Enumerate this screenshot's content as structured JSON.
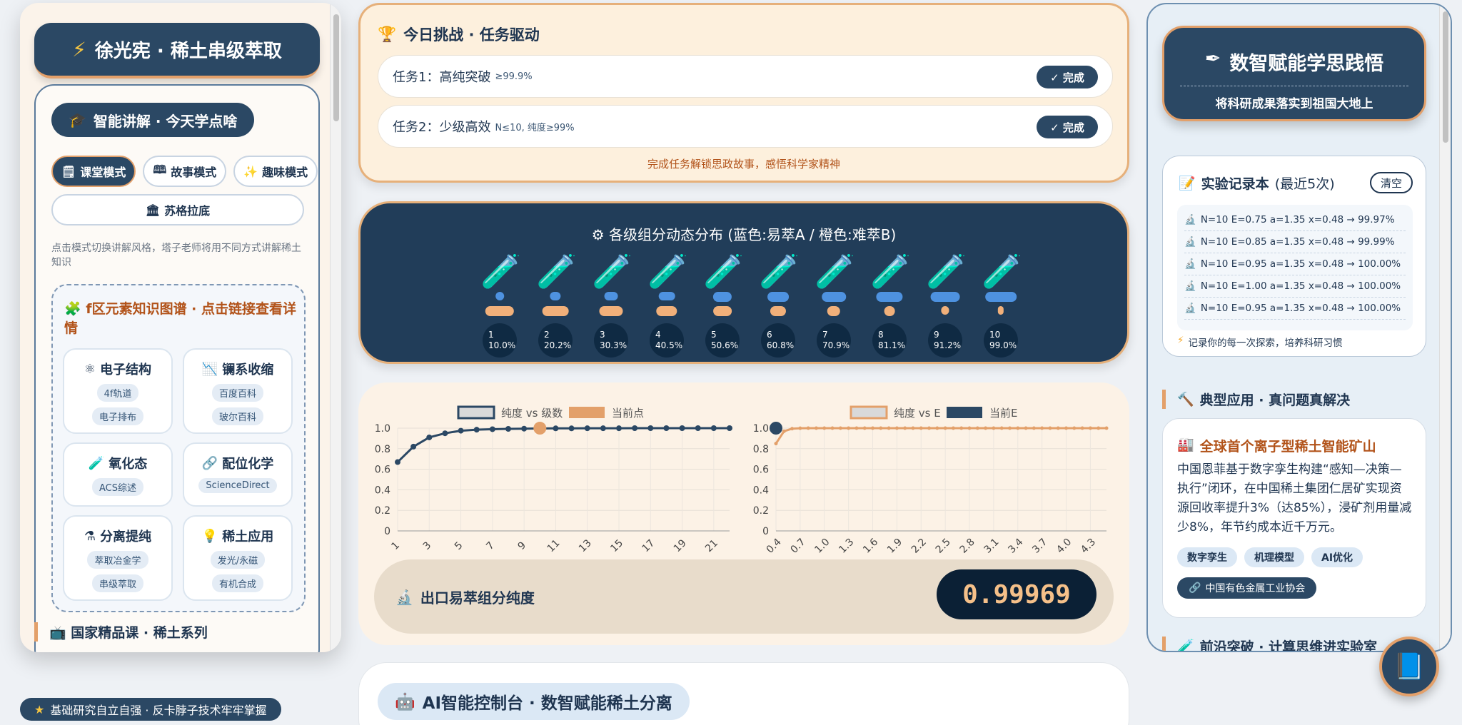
{
  "left": {
    "brand": "徐光宪 · 稀土串级萃取",
    "brand_icon": "lightning-icon",
    "lecture_title": "智能讲解 · 今天学点啥",
    "modes": [
      "课堂模式",
      "故事模式",
      "趣味模式"
    ],
    "socratic": "苏格拉底",
    "hint": "点击模式切换讲解风格，塔子老师将用不同方式讲解稀土知识",
    "kg_title": "f区元素知识图谱 · 点击链接查看详情",
    "cards": [
      {
        "title": "电子结构",
        "tags": [
          "4f轨道",
          "电子排布"
        ]
      },
      {
        "title": "镧系收缩",
        "tags": [
          "百度百科",
          "玻尔百科"
        ]
      },
      {
        "title": "氧化态",
        "tags": [
          "ACS综述"
        ]
      },
      {
        "title": "配位化学",
        "tags": [
          "ScienceDirect"
        ]
      },
      {
        "title": "分离提纯",
        "tags": [
          "萃取冶金学",
          "串级萃取"
        ]
      },
      {
        "title": "稀土应用",
        "tags": [
          "发光/永磁",
          "有机合成"
        ]
      }
    ],
    "course_title": "国家精品课 · 稀土系列"
  },
  "banner": "基础研究自立自强 · 反卡脖子技术牢牢掌握",
  "task": {
    "title": "今日挑战 · 任务驱动",
    "items": [
      {
        "label": "任务1：高纯突破",
        "detail": "≥99.9%",
        "status": "✓ 完成"
      },
      {
        "label": "任务2：少级高效",
        "detail": "N≤10, 纯度≥99%",
        "status": "✓ 完成"
      }
    ],
    "note": "完成任务解锁思政故事，感悟科学家精神"
  },
  "dist": {
    "title": "各级组分动态分布 (蓝色:易萃A / 橙色:难萃B)",
    "stages": [
      {
        "n": "1",
        "pct": "10.0%",
        "a": 0.1
      },
      {
        "n": "2",
        "pct": "20.2%",
        "a": 0.202
      },
      {
        "n": "3",
        "pct": "30.3%",
        "a": 0.303
      },
      {
        "n": "4",
        "pct": "40.5%",
        "a": 0.405
      },
      {
        "n": "5",
        "pct": "50.6%",
        "a": 0.506
      },
      {
        "n": "6",
        "pct": "60.8%",
        "a": 0.608
      },
      {
        "n": "7",
        "pct": "70.9%",
        "a": 0.709
      },
      {
        "n": "8",
        "pct": "81.1%",
        "a": 0.811
      },
      {
        "n": "9",
        "pct": "91.2%",
        "a": 0.912
      },
      {
        "n": "10",
        "pct": "99.0%",
        "a": 0.99
      }
    ]
  },
  "chart_data": [
    {
      "type": "line",
      "series": [
        {
          "name": "纯度 vs 级数",
          "x": [
            1,
            2,
            3,
            4,
            5,
            6,
            7,
            8,
            9,
            10,
            11,
            12,
            13,
            14,
            15,
            16,
            17,
            18,
            19,
            20,
            21,
            22
          ],
          "values": [
            0.67,
            0.82,
            0.91,
            0.95,
            0.975,
            0.985,
            0.99,
            0.993,
            0.995,
            0.997,
            0.998,
            0.998,
            0.999,
            0.999,
            0.999,
            1.0,
            1.0,
            1.0,
            1.0,
            1.0,
            1.0,
            1.0
          ]
        },
        {
          "name": "当前点",
          "x": [
            10
          ],
          "values": [
            0.9997
          ]
        }
      ],
      "ylim": [
        0,
        1.0
      ],
      "yticks": [
        "0",
        "0.2",
        "0.4",
        "0.6",
        "0.8",
        "1.0"
      ],
      "xticks": [
        "1",
        "3",
        "5",
        "7",
        "9",
        "11",
        "13",
        "15",
        "17",
        "19",
        "21"
      ]
    },
    {
      "type": "line",
      "series": [
        {
          "name": "纯度 vs E",
          "x": [
            0.4,
            0.5,
            0.6,
            0.7,
            0.8,
            0.9,
            1.0,
            1.1,
            1.2,
            1.3,
            1.4,
            1.5,
            1.6,
            1.7,
            1.8,
            1.9,
            2.0,
            2.1,
            2.2,
            2.3,
            2.4,
            2.5,
            2.6,
            2.7,
            2.8,
            2.9,
            3.0,
            3.1,
            3.2,
            3.3,
            3.4,
            3.5,
            3.6,
            3.7,
            3.8,
            3.9,
            4.0,
            4.1,
            4.2,
            4.3,
            4.4,
            4.5
          ],
          "values": [
            0.85,
            0.97,
            0.995,
            0.999,
            1.0,
            1.0,
            1.0,
            1.0,
            1.0,
            1.0,
            1.0,
            1.0,
            1.0,
            1.0,
            1.0,
            1.0,
            1.0,
            1.0,
            1.0,
            1.0,
            1.0,
            1.0,
            1.0,
            1.0,
            1.0,
            1.0,
            1.0,
            1.0,
            1.0,
            1.0,
            1.0,
            1.0,
            1.0,
            1.0,
            1.0,
            1.0,
            1.0,
            1.0,
            1.0,
            1.0,
            1.0,
            1.0
          ]
        },
        {
          "name": "当前E",
          "x": [
            0.4
          ],
          "values": [
            1.0
          ]
        }
      ],
      "ylim": [
        0,
        1.0
      ],
      "yticks": [
        "0",
        "0.2",
        "0.4",
        "0.6",
        "0.8",
        "1.0"
      ],
      "xticks": [
        "0.4",
        "0.7",
        "1.0",
        "1.3",
        "1.6",
        "1.9",
        "2.2",
        "2.5",
        "2.8",
        "3.1",
        "3.4",
        "3.7",
        "4.0",
        "4.3"
      ]
    }
  ],
  "output": {
    "label": "出口易萃组分纯度",
    "value": "0.99969"
  },
  "ai_title": "AI智能控制台 · 数智赋能稀土分离",
  "right": {
    "brand": "数智赋能学思践悟",
    "brand_sub": "将科研成果落实到祖国大地上",
    "records_title": "实验记录本",
    "records_sub": "(最近5次)",
    "clear": "清空",
    "records": [
      "N=10 E=0.75 a=1.35 x=0.48 → 99.97%",
      "N=10 E=0.85 a=1.35 x=0.48 → 99.99%",
      "N=10 E=0.95 a=1.35 x=0.48 → 100.00%",
      "N=10 E=1.00 a=1.35 x=0.48 → 100.00%",
      "N=10 E=0.95 a=1.35 x=0.48 → 100.00%"
    ],
    "records_foot": "记录你的每一次探索，培养科研习惯",
    "apps_title": "典型应用 · 真问题真解决",
    "app_title": "全球首个离子型稀土智能矿山",
    "app_text": "中国恩菲基于数字孪生构建“感知—决策—执行”闭环，在中国稀土集团仁居矿实现资源回收率提升3%（达85%），浸矿剂用量减少8%，年节约成本近千万元。",
    "app_tags": [
      "数字孪生",
      "机理模型",
      "AI优化"
    ],
    "app_link": "中国有色金属工业协会",
    "frontier_title": "前沿突破 · 计算思维进实验室"
  },
  "colors": {
    "navy": "#2b4864",
    "orange": "#e3a06a",
    "teal": "#2bc4a0",
    "blue": "#4e92e0"
  }
}
